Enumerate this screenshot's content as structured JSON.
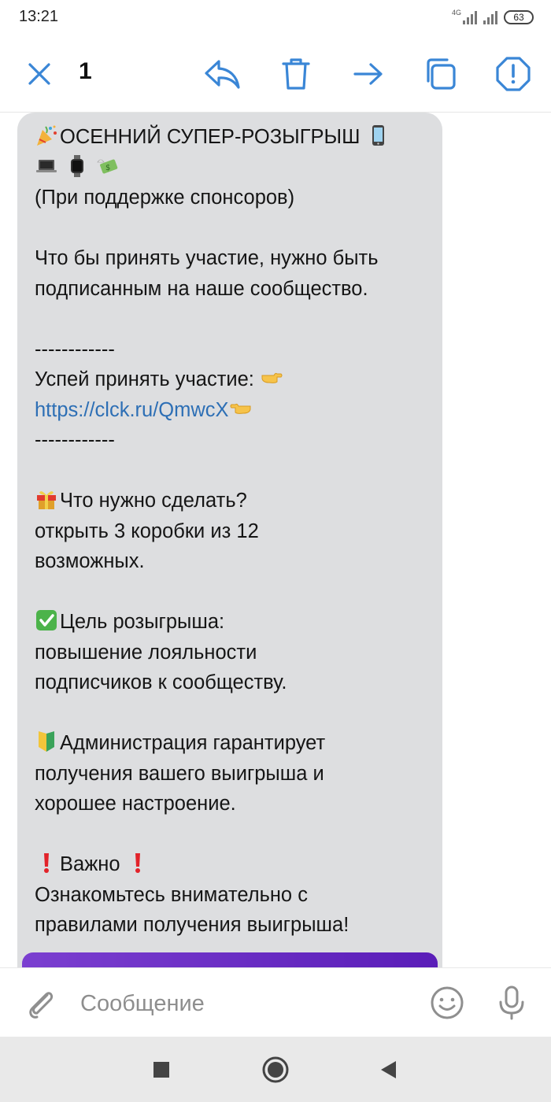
{
  "status_bar": {
    "time": "13:21",
    "network": "4G",
    "battery": "63"
  },
  "toolbar": {
    "selected_count": "1",
    "icons": [
      "close-icon",
      "reply-icon",
      "trash-icon",
      "forward-icon",
      "copy-icon",
      "report-icon"
    ],
    "accent_color": "#3a86d6"
  },
  "message": {
    "lines": [
      "ОСЕННИЙ СУПЕР-РОЗЫГРЫШ",
      "(При поддержке спонсоров)",
      "",
      "Что бы принять участие, нужно быть",
      "подписанным на наше сообщество.",
      "",
      "------------",
      "Успей принять участие:",
      "https://clck.ru/QmwcX",
      "------------",
      "",
      "Что нужно сделать?",
      "открыть 3 коробки из 12",
      "возможных.",
      "",
      "Цель розыгрыша:",
      "повышение лояльности",
      "подписчиков к сообществу.",
      "",
      "Администрация гарантирует",
      "получения вашего выигрыша и",
      "хорошее настроение.",
      "",
      "Важно",
      "Ознакомьтесь внимательно с",
      "правилами получения выигрыша!"
    ],
    "bubble_color": "#dddee0",
    "link_color": "#2d6fb5",
    "attachment_color": "#6a2ec8"
  },
  "composer": {
    "placeholder": "Сообщение",
    "icons": [
      "attach-icon",
      "emoji-icon",
      "microphone-icon"
    ]
  },
  "nav_bar": {
    "icons": [
      "recents-square-icon",
      "home-circle-icon",
      "back-triangle-icon"
    ]
  }
}
